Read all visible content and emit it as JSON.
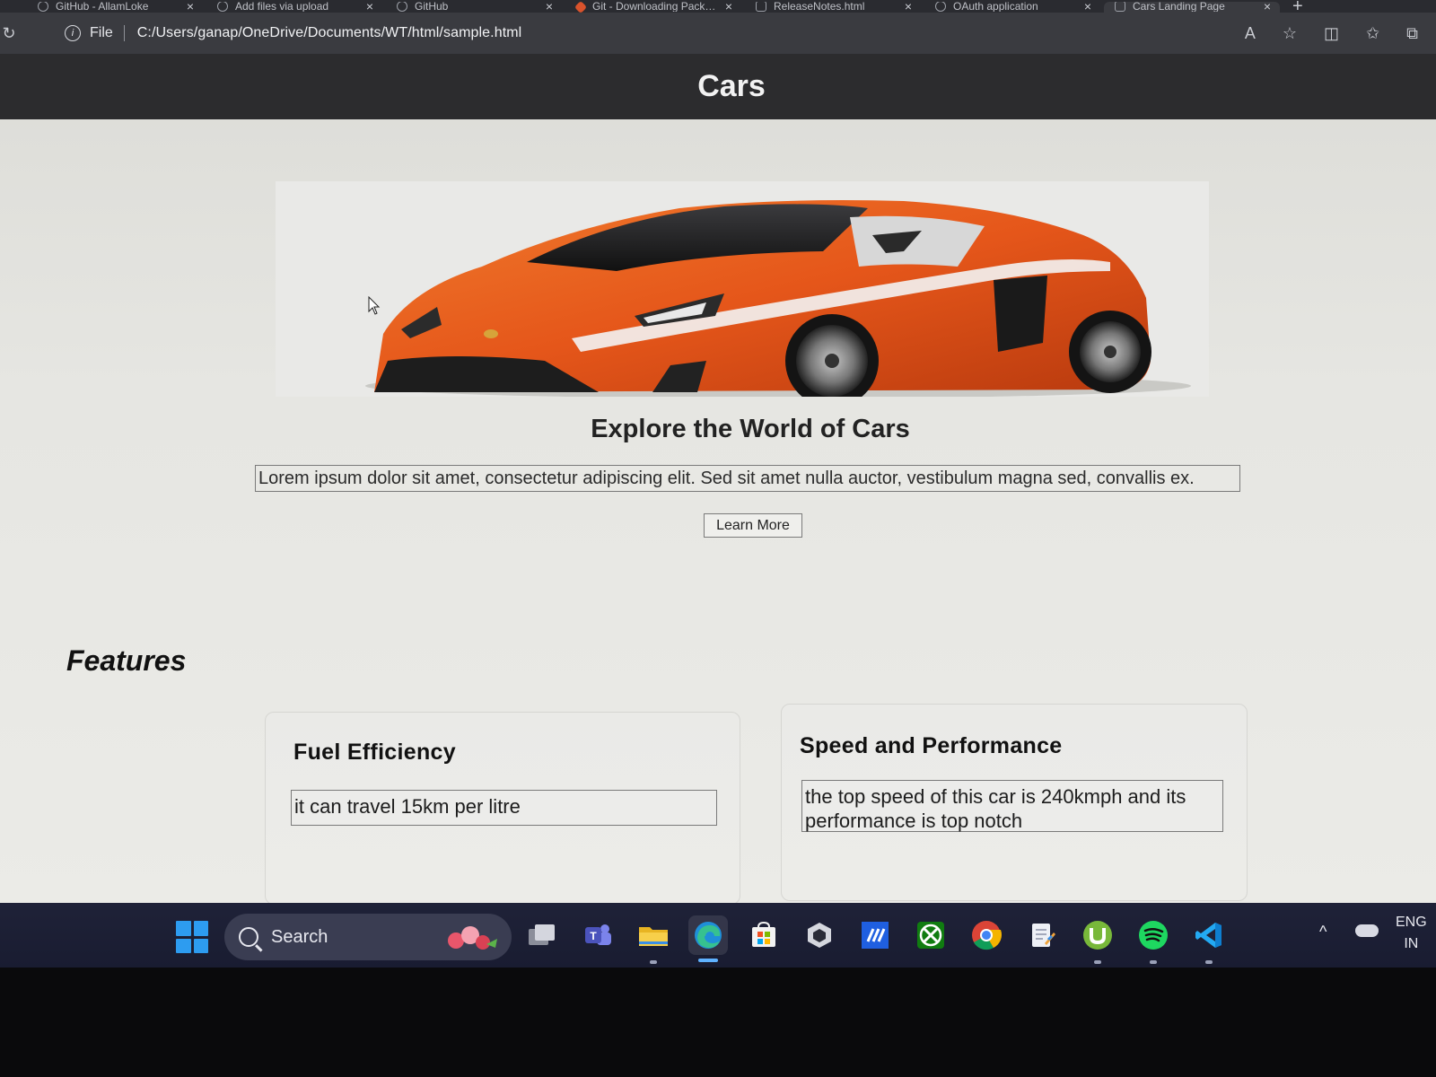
{
  "browser": {
    "tabs": [
      {
        "title": "GitHub - AllamLoke",
        "icon": "github-icon"
      },
      {
        "title": "Add files via upload",
        "icon": "github-icon"
      },
      {
        "title": "GitHub",
        "icon": "github-icon"
      },
      {
        "title": "Git - Downloading Package",
        "icon": "git-icon"
      },
      {
        "title": "ReleaseNotes.html",
        "icon": "page-icon"
      },
      {
        "title": "OAuth application",
        "icon": "github-icon"
      },
      {
        "title": "Cars Landing Page",
        "icon": "page-icon",
        "active": true
      }
    ],
    "address": {
      "scheme_label": "File",
      "url": "C:/Users/ganap/OneDrive/Documents/WT/html/sample.html"
    }
  },
  "page": {
    "site_title": "Cars",
    "hero": {
      "title": "Explore the World of Cars",
      "description": "Lorem ipsum dolor sit amet, consectetur adipiscing elit. Sed sit amet nulla auctor, vestibulum magna sed, convallis ex.",
      "button_label": "Learn More"
    },
    "features": {
      "title": "Features",
      "cards": [
        {
          "heading": "Fuel Efficiency",
          "text": "it can travel 15km per litre"
        },
        {
          "heading": "Speed and Performance",
          "text": "the top speed of this car is 240kmph and its performance is top notch"
        }
      ]
    }
  },
  "taskbar": {
    "search_label": "Search",
    "language": "ENG",
    "region": "IN",
    "apps": [
      "task-view",
      "teams",
      "file-explorer",
      "edge",
      "store",
      "unity",
      "jetbrains",
      "xbox",
      "chrome",
      "notepad",
      "utorrent",
      "spotify",
      "vscode"
    ]
  },
  "colors": {
    "header_bg": "#2c2c2e",
    "car_orange": "#e5561a",
    "taskbar_bg": "#1f2238",
    "accent_blue": "#2d9cf0"
  }
}
